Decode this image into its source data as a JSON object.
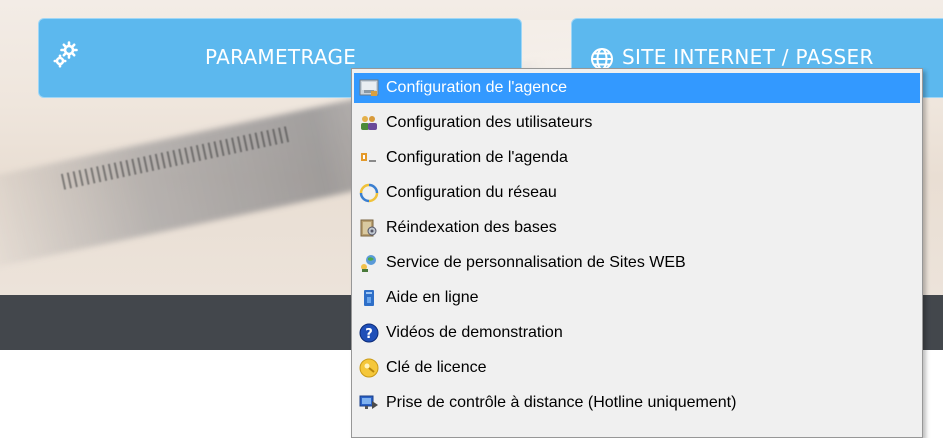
{
  "tiles": [
    {
      "label": "PARAMETRAGE",
      "icon": "gears-icon"
    },
    {
      "label": "SITE INTERNET / PASSER",
      "icon": "globe-icon"
    }
  ],
  "menu": {
    "items": [
      {
        "label": "Configuration de l'agence",
        "icon": "agency-config-icon",
        "active": true
      },
      {
        "label": "Configuration des utilisateurs",
        "icon": "users-icon",
        "active": false
      },
      {
        "label": "Configuration de l'agenda",
        "icon": "agenda-icon",
        "active": false
      },
      {
        "label": "Configuration du réseau",
        "icon": "network-icon",
        "active": false
      },
      {
        "label": "Réindexation des bases",
        "icon": "reindex-icon",
        "active": false
      },
      {
        "label": "Service de personnalisation de Sites WEB",
        "icon": "web-service-icon",
        "active": false
      },
      {
        "label": "Aide en ligne",
        "icon": "help-book-icon",
        "active": false
      },
      {
        "label": "Vidéos de demonstration",
        "icon": "question-icon",
        "active": false
      },
      {
        "label": "Clé de licence",
        "icon": "key-icon",
        "active": false
      },
      {
        "label": "Prise de contrôle à distance (Hotline uniquement)",
        "icon": "remote-control-icon",
        "active": false
      }
    ]
  },
  "colors": {
    "tile": "#5cb8ee",
    "menu_highlight": "#3399ff",
    "dark_bar": "#43474c"
  }
}
